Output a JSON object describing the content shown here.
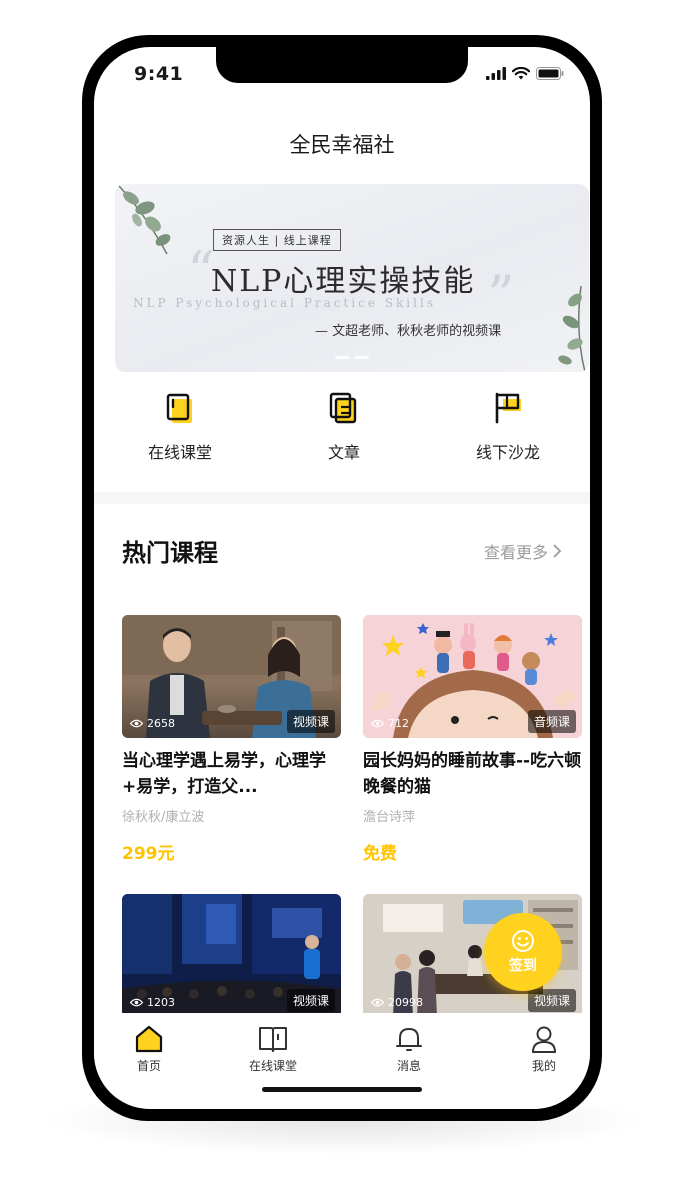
{
  "status_bar": {
    "time": "9:41"
  },
  "nav": {
    "title": "全民幸福社"
  },
  "banner": {
    "tag": "资源人生 | 线上课程",
    "title": "NLP心理实操技能",
    "subtitle_en": "NLP Psychological Practice Skills",
    "subtitle": "— 文超老师、秋秋老师的视频课"
  },
  "quick_entries": [
    {
      "label": "在线课堂",
      "icon": "book-icon"
    },
    {
      "label": "文章",
      "icon": "document-icon"
    },
    {
      "label": "线下沙龙",
      "icon": "flag-icon"
    }
  ],
  "section": {
    "title": "热门课程",
    "more": "查看更多"
  },
  "courses": [
    {
      "views": "2658",
      "type": "视频课",
      "title": "当心理学遇上易学，心理学+易学，打造父...",
      "author": "徐秋秋/康立波",
      "price": "299元"
    },
    {
      "views": "712",
      "type": "音频课",
      "title": "园长妈妈的睡前故事--吃六顿晚餐的猫",
      "author": "澹台诗萍",
      "price": "免费"
    },
    {
      "views": "1203",
      "type": "视频课"
    },
    {
      "views": "20998",
      "type": "视频课"
    }
  ],
  "signin": {
    "label": "签到"
  },
  "tabbar": [
    {
      "label": "首页",
      "icon": "home-icon",
      "active": true
    },
    {
      "label": "在线课堂",
      "icon": "open-book-icon"
    },
    {
      "label": "消息",
      "icon": "bell-icon"
    },
    {
      "label": "我的",
      "icon": "user-icon"
    }
  ],
  "colors": {
    "accent": "#ffd21f",
    "price": "#ffc400",
    "muted": "#9b9b9b"
  }
}
